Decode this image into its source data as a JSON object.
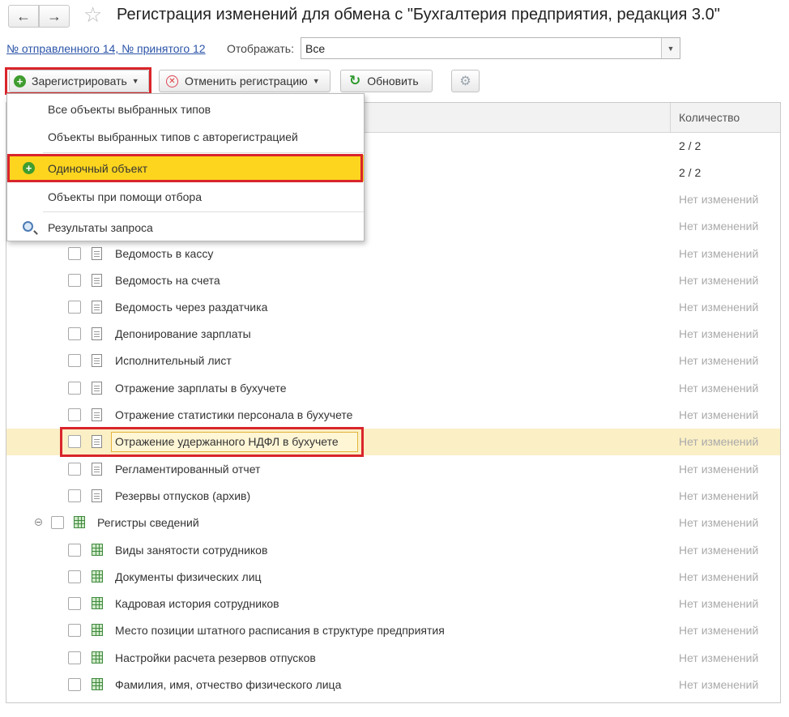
{
  "header": {
    "title": "Регистрация изменений для обмена с  \"Бухгалтерия предприятия, редакция 3.0\"",
    "back_icon": "arrow-left-icon",
    "forward_icon": "arrow-right-icon",
    "favorite_icon": "star-icon"
  },
  "filter": {
    "link_text": "№ отправленного 14, № принятого 12",
    "show_label": "Отображать:",
    "show_value": "Все"
  },
  "toolbar": {
    "register_label": "Зарегистрировать",
    "cancel_label": "Отменить регистрацию",
    "refresh_label": "Обновить"
  },
  "menu": {
    "items": [
      {
        "label": "Все объекты выбранных типов"
      },
      {
        "label": "Объекты выбранных типов с авторегистрацией"
      },
      {
        "label": "Одиночный объект"
      },
      {
        "label": "Объекты при помощи отбора"
      },
      {
        "label": "Результаты запроса"
      }
    ]
  },
  "grid": {
    "column_count": "Количество",
    "rows": [
      {
        "name": "",
        "count": "2 / 2"
      },
      {
        "name": "",
        "count": "2 / 2"
      },
      {
        "name": "",
        "count": "Нет изменений"
      },
      {
        "name": "",
        "count": "Нет изменений"
      },
      {
        "name": "Ведомость в кассу",
        "count": "Нет изменений"
      },
      {
        "name": "Ведомость на счета",
        "count": "Нет изменений"
      },
      {
        "name": "Ведомость через раздатчика",
        "count": "Нет изменений"
      },
      {
        "name": "Депонирование зарплаты",
        "count": "Нет изменений"
      },
      {
        "name": "Исполнительный лист",
        "count": "Нет изменений"
      },
      {
        "name": "Отражение зарплаты в бухучете",
        "count": "Нет изменений"
      },
      {
        "name": "Отражение статистики персонала в бухучете",
        "count": "Нет изменений"
      },
      {
        "name": "Отражение удержанного НДФЛ в бухучете",
        "count": "Нет изменений"
      },
      {
        "name": "Регламентированный отчет",
        "count": "Нет изменений"
      },
      {
        "name": "Резервы отпусков (архив)",
        "count": "Нет изменений"
      },
      {
        "name": "Регистры сведений",
        "count": "Нет изменений"
      },
      {
        "name": "Виды занятости сотрудников",
        "count": "Нет изменений"
      },
      {
        "name": "Документы физических лиц",
        "count": "Нет изменений"
      },
      {
        "name": "Кадровая история сотрудников",
        "count": "Нет изменений"
      },
      {
        "name": "Место позиции штатного расписания в структуре предприятия",
        "count": "Нет изменений"
      },
      {
        "name": "Настройки расчета резервов отпусков",
        "count": "Нет изменений"
      },
      {
        "name": "Фамилия, имя, отчество физического лица",
        "count": "Нет изменений"
      }
    ]
  }
}
